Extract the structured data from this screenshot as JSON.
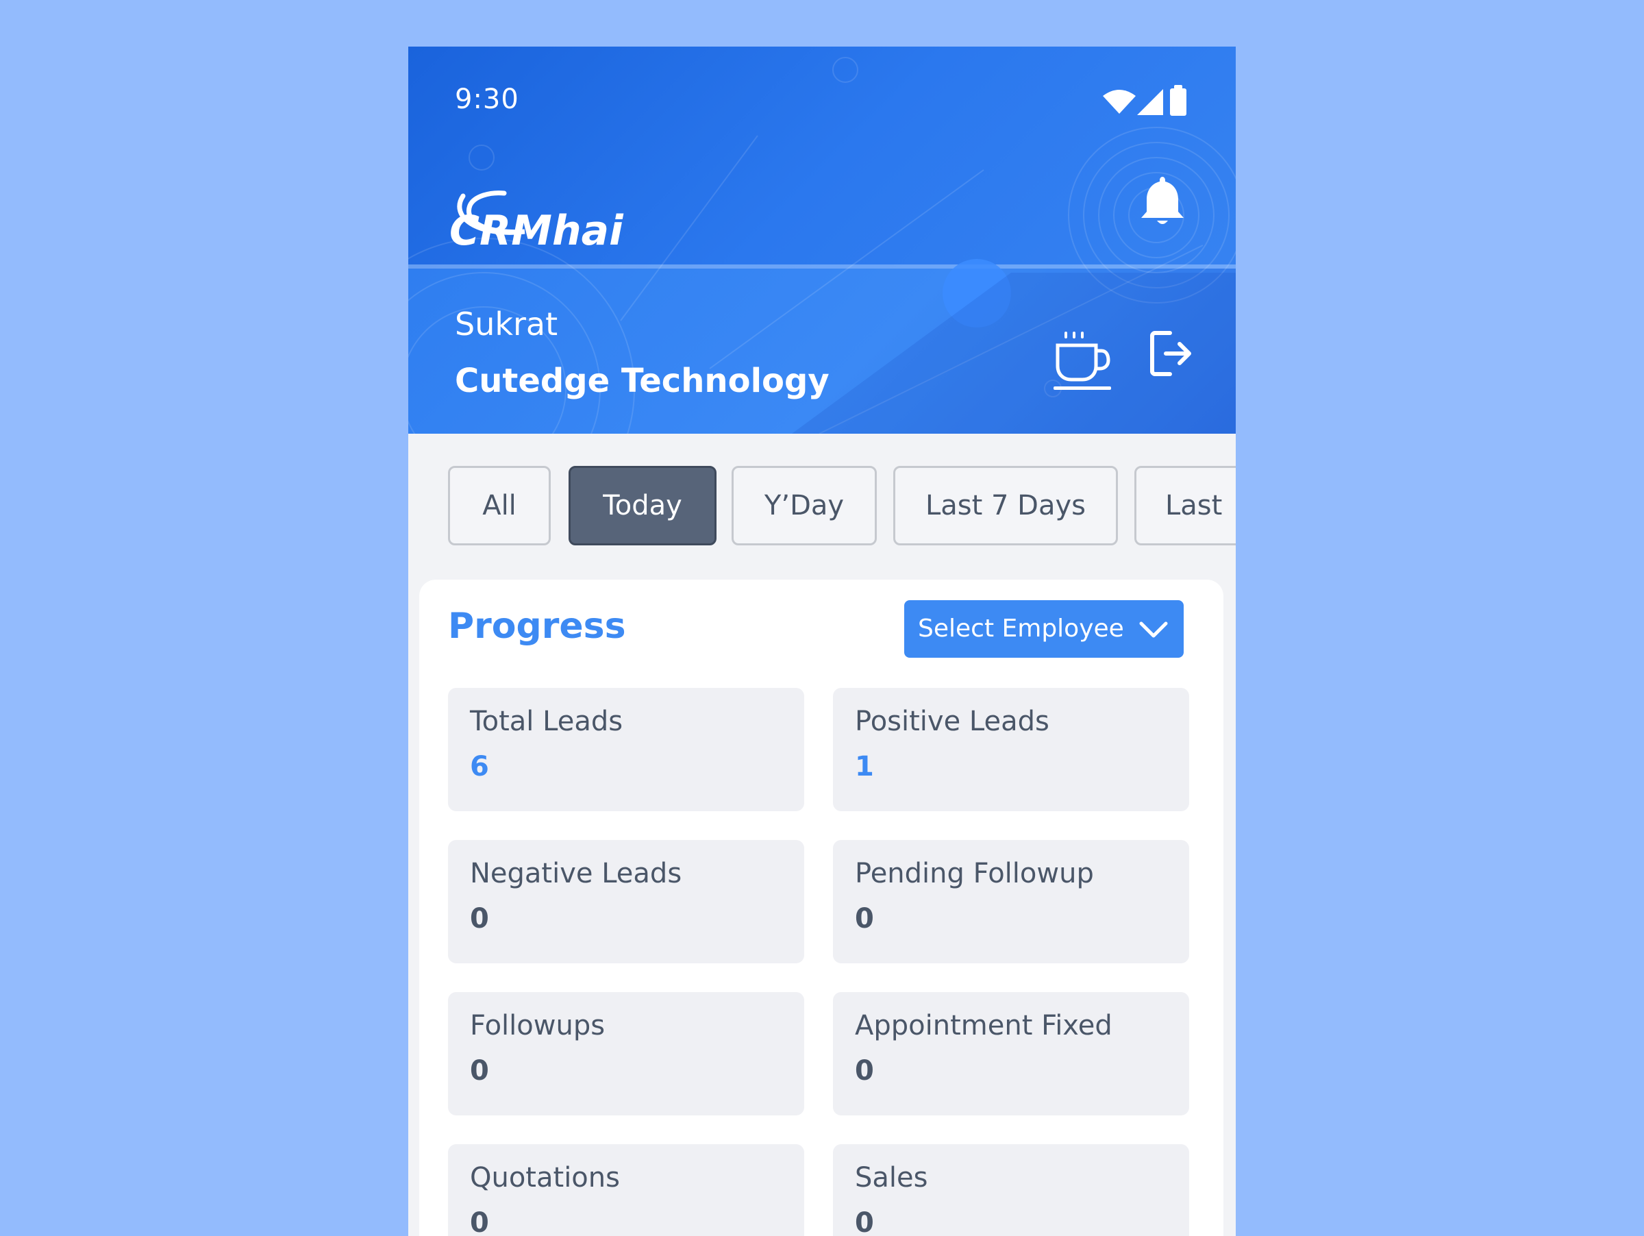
{
  "status_bar": {
    "time": "9:30",
    "icons": [
      "wifi-icon",
      "signal-icon",
      "battery-icon"
    ]
  },
  "header": {
    "logo_text": "CRMhai",
    "notification_icon": "bell-icon",
    "user_name": "Sukrat",
    "company_name": "Cutedge Technology",
    "break_icon": "coffee-cup-icon",
    "logout_icon": "logout-icon"
  },
  "filters": {
    "tabs": [
      {
        "label": "All",
        "active": false
      },
      {
        "label": "Today",
        "active": true
      },
      {
        "label": "Y’Day",
        "active": false
      },
      {
        "label": "Last 7 Days",
        "active": false
      },
      {
        "label": "Last",
        "active": false
      }
    ]
  },
  "progress": {
    "title": "Progress",
    "employee_select": {
      "label": "Select Employee",
      "icon": "chevron-down-icon"
    },
    "stats": [
      {
        "label": "Total Leads",
        "value": "6",
        "highlight": true
      },
      {
        "label": "Positive Leads",
        "value": "1",
        "highlight": true
      },
      {
        "label": "Negative Leads",
        "value": "0",
        "highlight": false
      },
      {
        "label": "Pending Followup",
        "value": "0",
        "highlight": false
      },
      {
        "label": "Followups",
        "value": "0",
        "highlight": false
      },
      {
        "label": "Appointment Fixed",
        "value": "0",
        "highlight": false
      },
      {
        "label": "Quotations",
        "value": "0",
        "highlight": false
      },
      {
        "label": "Sales",
        "value": "0",
        "highlight": false
      }
    ]
  },
  "colors": {
    "page_background": "#93bbfd",
    "header_blue": "#2b78ee",
    "accent": "#3d8af3",
    "active_tab": "#576479",
    "stat_background": "#eff0f4",
    "text_gray": "#4a5668"
  }
}
